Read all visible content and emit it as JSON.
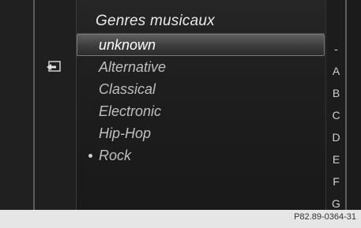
{
  "header": {
    "title": "Genres musicaux"
  },
  "back_button": {
    "icon": "back-arrow-icon"
  },
  "genres": [
    {
      "label": "unknown",
      "selected": true,
      "current": false
    },
    {
      "label": "Alternative",
      "selected": false,
      "current": false
    },
    {
      "label": "Classical",
      "selected": false,
      "current": false
    },
    {
      "label": "Electronic",
      "selected": false,
      "current": false
    },
    {
      "label": "Hip-Hop",
      "selected": false,
      "current": false
    },
    {
      "label": "Rock",
      "selected": false,
      "current": true
    }
  ],
  "alphabet": [
    "-",
    "A",
    "B",
    "C",
    "D",
    "E",
    "F",
    "G"
  ],
  "caption": "P82.89-0364-31"
}
